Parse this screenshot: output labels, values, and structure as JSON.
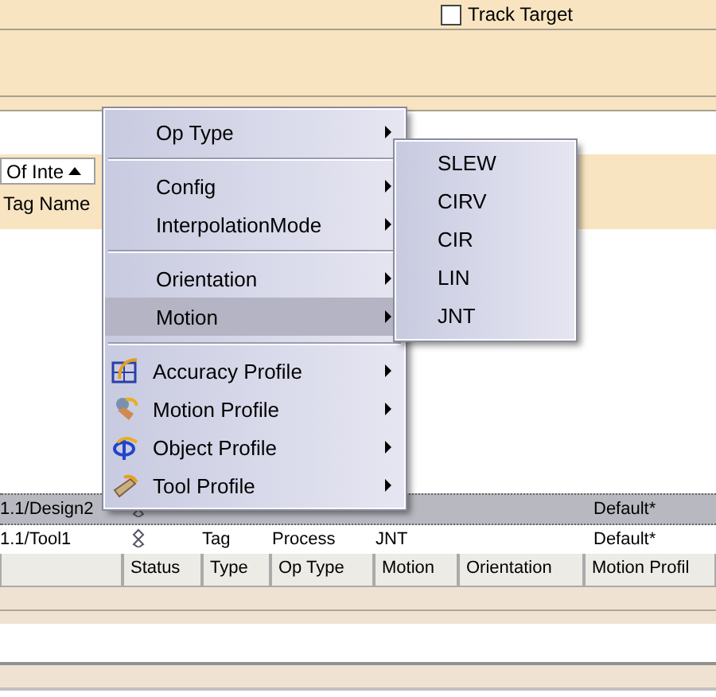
{
  "track_target": {
    "label": "Track Target",
    "checked": false
  },
  "filter": {
    "value": "Of Inte"
  },
  "tag_column": {
    "label": "Tag Name"
  },
  "table": {
    "rows": [
      {
        "name": "1.1/Design2",
        "motion_profile": "Default*",
        "selected": true
      },
      {
        "name": "1.1/Tool1",
        "type": "Tag",
        "op_type": "Process",
        "motion": "JNT",
        "motion_profile": "Default*",
        "selected": false
      }
    ],
    "columns": [
      "Status",
      "Type",
      "Op Type",
      "Motion",
      "Orientation",
      "Motion Profil"
    ]
  },
  "context_menu": {
    "items": [
      {
        "kind": "item",
        "label": "Op Type",
        "highlighted": false
      },
      {
        "kind": "separator"
      },
      {
        "kind": "item",
        "label": "Config",
        "highlighted": false
      },
      {
        "kind": "item",
        "label": "InterpolationMode",
        "highlighted": false
      },
      {
        "kind": "separator"
      },
      {
        "kind": "item",
        "label": "Orientation",
        "highlighted": false
      },
      {
        "kind": "item",
        "label": "Motion",
        "highlighted": true
      },
      {
        "kind": "separator"
      },
      {
        "kind": "profile",
        "label": "Accuracy Profile",
        "highlighted": false
      },
      {
        "kind": "profile",
        "label": "Motion Profile",
        "highlighted": false
      },
      {
        "kind": "profile",
        "label": "Object Profile",
        "highlighted": false
      },
      {
        "kind": "profile",
        "label": "Tool Profile",
        "highlighted": false
      }
    ]
  },
  "submenu": {
    "items": [
      "SLEW",
      "CIRV",
      "CIR",
      "LIN",
      "JNT"
    ]
  }
}
